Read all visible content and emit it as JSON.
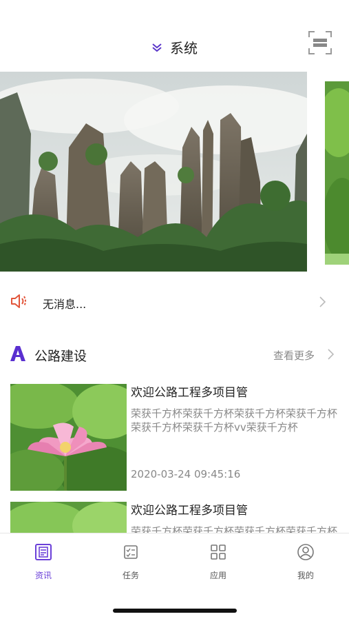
{
  "header": {
    "title": "系统"
  },
  "notice": {
    "text": "无消息..."
  },
  "section": {
    "title": "公路建设",
    "more_label": "查看更多"
  },
  "news": [
    {
      "title": "欢迎公路工程多项目管",
      "desc": "荣获千方杯荣获千方杯荣获千方杯荣获千方杯荣获千方杯荣获千方杯vv荣获千方杯",
      "date": "2020-03-24 09:45:16"
    },
    {
      "title": "欢迎公路工程多项目管",
      "desc": "荣获千方杯荣获千方杯荣获千方杯荣获千方杯荣获千方杯荣获千方杯",
      "date": ""
    }
  ],
  "tabs": [
    {
      "label": "资讯",
      "icon": "news-icon",
      "active": true
    },
    {
      "label": "任务",
      "icon": "task-icon",
      "active": false
    },
    {
      "label": "应用",
      "icon": "apps-grid-icon",
      "active": false
    },
    {
      "label": "我的",
      "icon": "profile-icon",
      "active": false
    }
  ],
  "colors": {
    "accent": "#6a3fd8",
    "notice_icon": "#e2553a",
    "muted_text": "#888888"
  }
}
